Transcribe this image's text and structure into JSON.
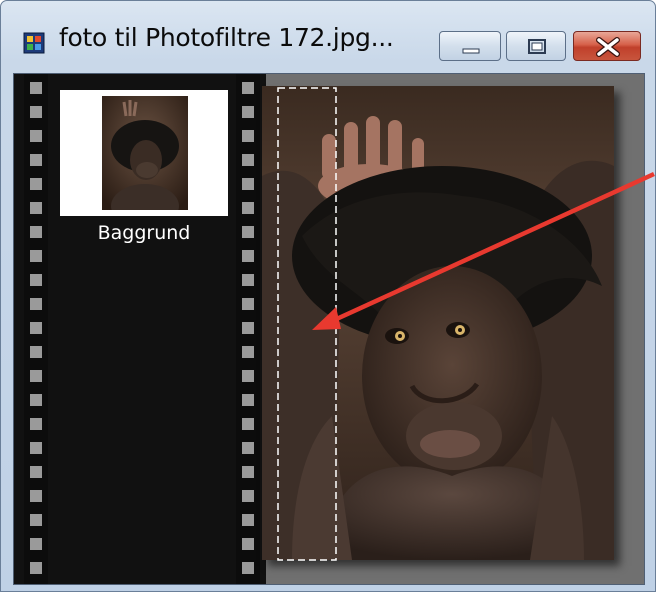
{
  "window": {
    "title": "foto til Photofiltre 172.jpg...",
    "controls": {
      "minimize": "minimize",
      "maximize": "maximize",
      "close": "close"
    },
    "icon": "photofiltre-app-icon"
  },
  "layers_panel": {
    "layers": [
      {
        "label": "Baggrund",
        "icon": "layer-thumbnail"
      }
    ]
  },
  "canvas": {
    "image": "photo of a chimpanzee with hands behind its head",
    "selection_tool": "rectangle-selection",
    "annotation": "red-arrow"
  },
  "colors": {
    "arrow": "#e8392f",
    "film_bg": "#111111",
    "film_hole": "#9a9a9a",
    "close_button": "#c8553d"
  }
}
